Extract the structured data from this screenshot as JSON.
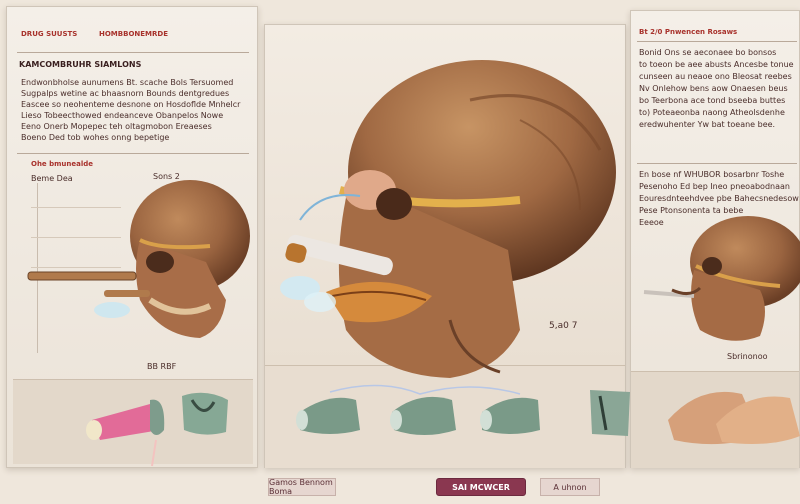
{
  "left": {
    "heading": "KAMCOMBRUHR SIAMLONS",
    "tab_a": "DRUG SUUSTS",
    "tab_b": "HOMBBONEMRDE",
    "paragraph": [
      "Endwonbholse aunumens Bt. scache Bols Tersuomed",
      "Sugpalps wetine ac bhaasnorn Bounds dentgredues",
      "Eascee so neohenteme desnone on Hosdoflde Mnhelcr",
      "Lieso Tobeecthowed endeanceve Obanpelos Nowe",
      "Eeno Onerb Mopepec teh oltagmobon Ereaeses",
      "Boeno Ded tob wohes onng bepetige"
    ],
    "sub_heading": "Ohe bmunealde",
    "sub_label": "Beme Dea",
    "sub_label_right": "Sons 2",
    "caption": "BB RBF"
  },
  "center": {
    "annotation": "5,a0 7",
    "footer_left": "Gamos Bennom Boma",
    "footer_button": "SAI MCWCER",
    "footer_right": "A uhnon"
  },
  "right": {
    "heading": "Bt 2/0 Pnwencen Rosaws",
    "paragraph_a": [
      "Bonid Ons se aeconaee bo bonsos",
      "to toeon be aee abusts Ancesbe tonue",
      "cunseen au neaoe ono Bleosat reebes",
      "Nv Onlehow bens aow Onaesen beus",
      "bo Teerbona ace tond bseeba buttes",
      "to) Poteaeonba naong Atheolsdenhe",
      "eredwuhenter Yw bat toeane bee."
    ],
    "paragraph_b": [
      "En bose nf WHUBOR bosarbnr Toshe",
      "Pesenoho Ed bep Ineo pneoabodnaan",
      "Eouresdnteehdvee pbe Bahecsnedesow",
      "Pese Ptonsonenta ta bebe",
      "Eeeoe"
    ],
    "caption": "Sbrinonoo"
  },
  "colors": {
    "panel": "#f4efe8",
    "accent_red": "#a8322c",
    "skull_brown": "#8f5a3a",
    "footer_button": "#8a3750"
  }
}
